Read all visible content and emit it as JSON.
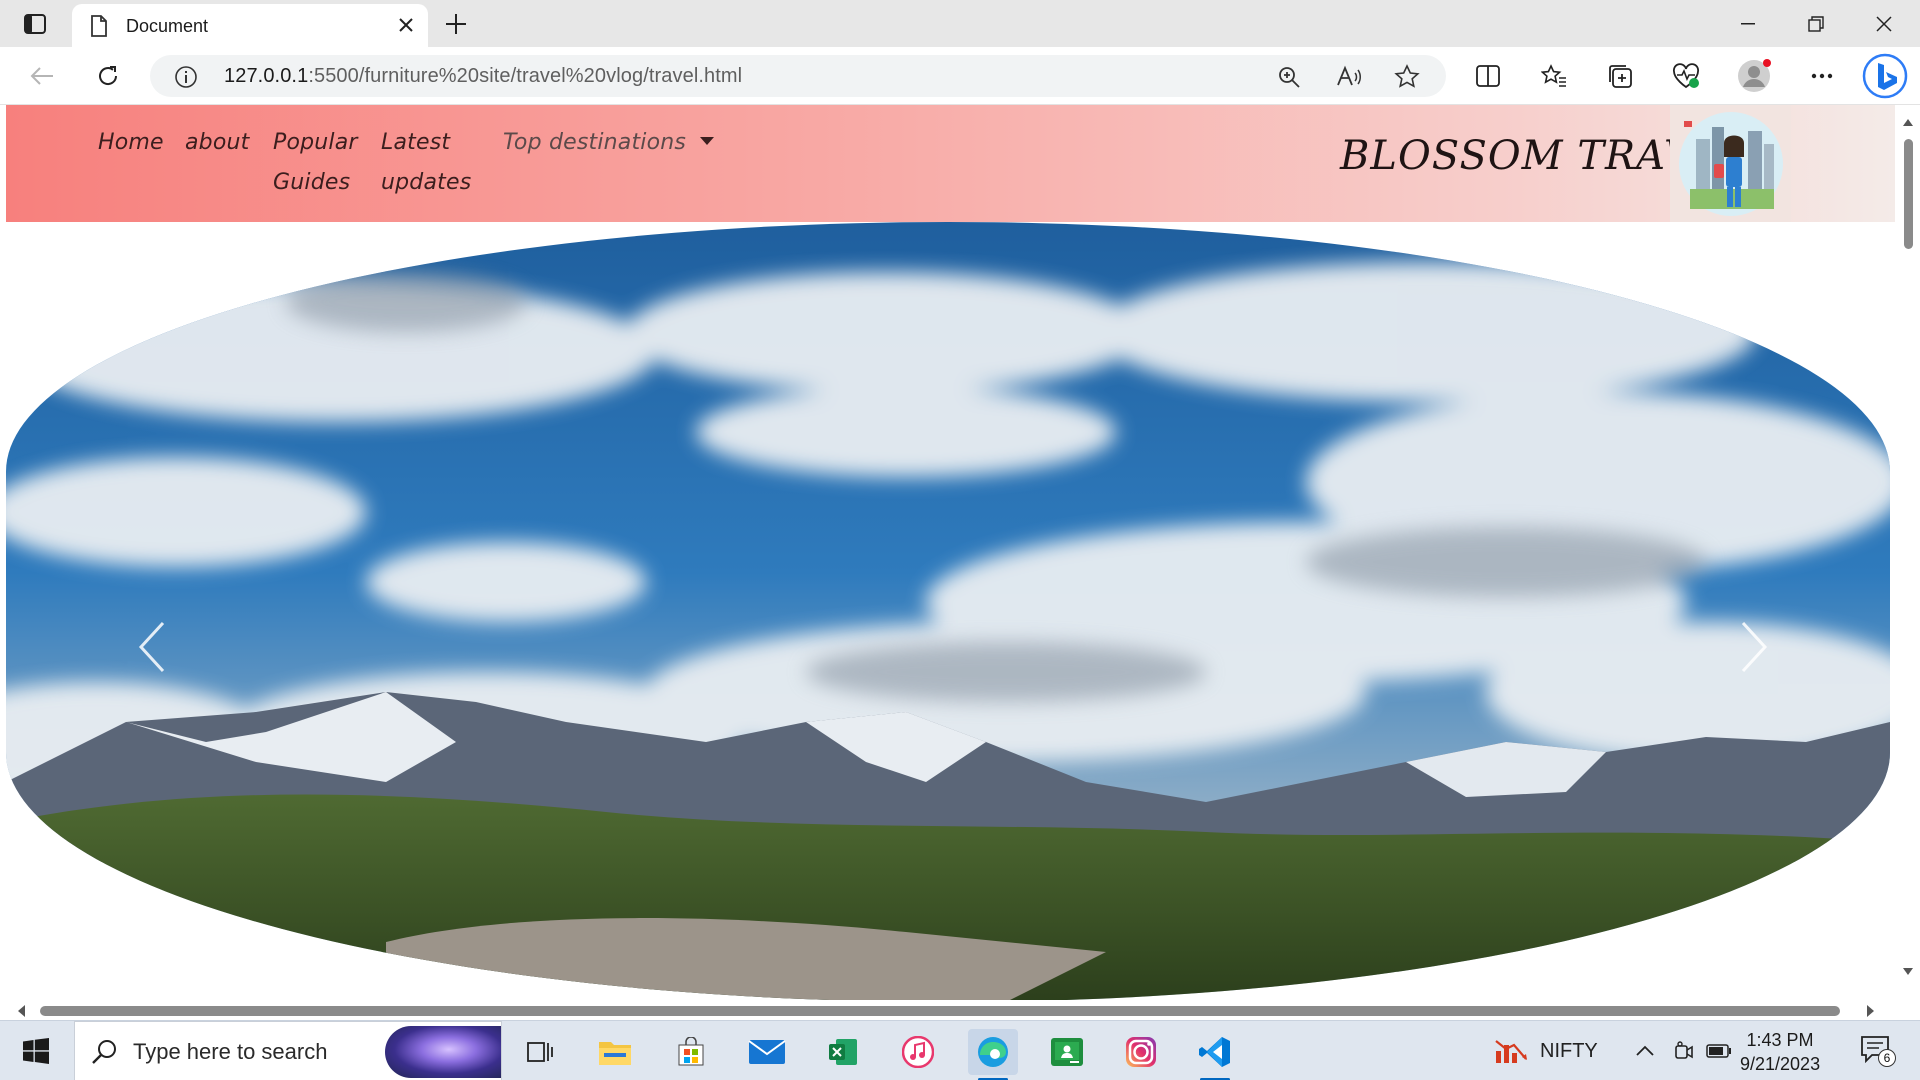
{
  "browser": {
    "tab_title": "Document",
    "url_host": "127.0.0.1",
    "url_path": ":5500/furniture%20site/travel%20vlog/travel.html"
  },
  "site": {
    "nav": [
      {
        "label": "Home"
      },
      {
        "label": "about"
      },
      {
        "label": "Popular"
      },
      {
        "label": "Guides"
      },
      {
        "label": "Latest"
      },
      {
        "label": "updates"
      }
    ],
    "dropdown_label": "Top destinations",
    "brand": "BLOSSOM TRAVEL"
  },
  "carousel": {
    "prev_label": "Previous",
    "next_label": "Next"
  },
  "taskbar": {
    "search_placeholder": "Type here to search",
    "nifty_label": "NIFTY",
    "time": "1:43 PM",
    "date": "9/21/2023",
    "notification_count": "6"
  },
  "colors": {
    "header_start": "#f7807d",
    "header_end": "#f4ebe8",
    "accent": "#0067c0"
  }
}
